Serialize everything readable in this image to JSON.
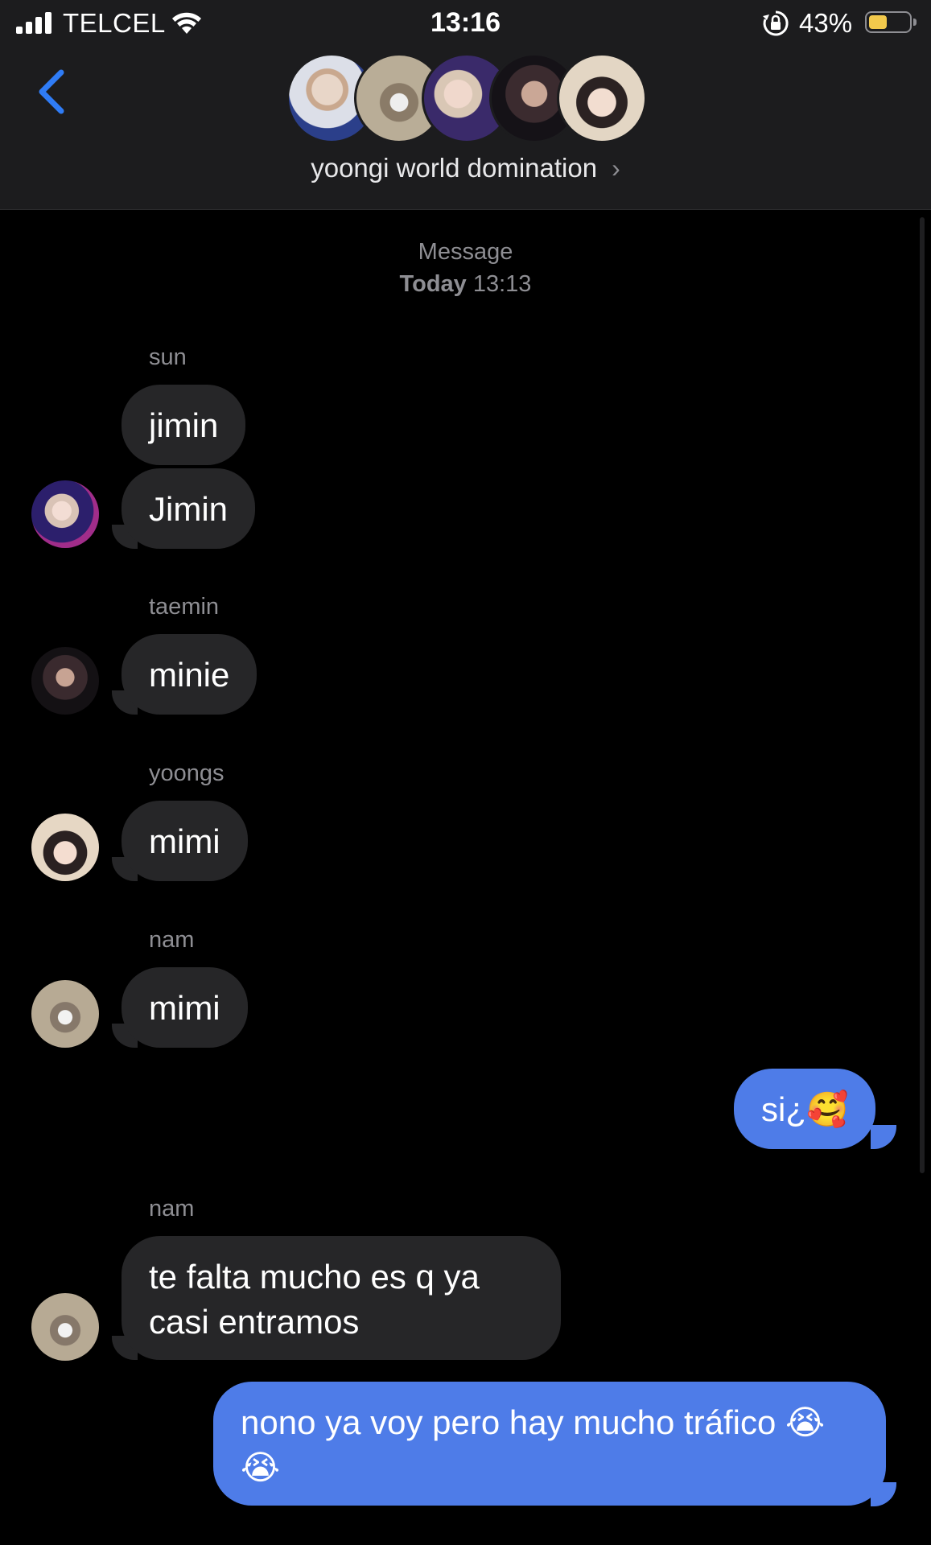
{
  "status_bar": {
    "carrier": "TELCEL",
    "time": "13:16",
    "battery": "43%",
    "battery_level": 0.43
  },
  "header": {
    "group_name": "yoongi world domination",
    "chevron": "›",
    "back_icon": "chevron-left-icon"
  },
  "thread": {
    "timestamp_label": "Message",
    "timestamp_day": "Today",
    "timestamp_time": "13:13",
    "messages": [
      {
        "sender": "sun",
        "text": "jimin"
      },
      {
        "text": "Jimin"
      },
      {
        "sender": "taemin",
        "text": "minie"
      },
      {
        "sender": "yoongs",
        "text": "mimi"
      },
      {
        "sender": "nam",
        "text": "mimi"
      },
      {
        "outgoing": true,
        "text": "si¿🥰"
      },
      {
        "sender": "nam",
        "text": "te falta mucho es q ya casi entramos"
      },
      {
        "outgoing": true,
        "text": "nono ya voy pero hay mucho tráfico 😭😭"
      }
    ]
  },
  "colors": {
    "incoming_bubble": "#262628",
    "outgoing_bubble": "#4e7ce8",
    "accent": "#2f7cf6",
    "header_bg": "#1c1c1e"
  }
}
